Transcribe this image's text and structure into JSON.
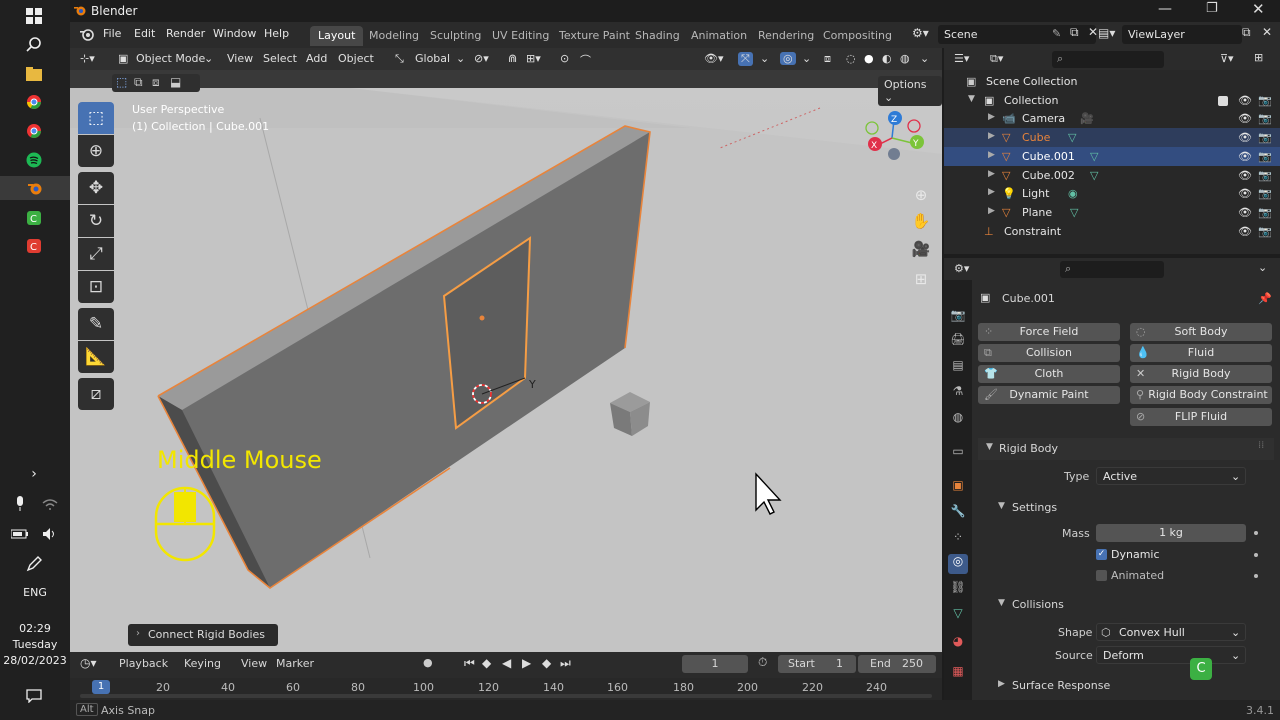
{
  "taskbar": {
    "time": "02:29",
    "day": "Tuesday",
    "date": "28/02/2023",
    "lang": "ENG"
  },
  "window": {
    "title": "Blender"
  },
  "menu": [
    "File",
    "Edit",
    "Render",
    "Window",
    "Help"
  ],
  "workspaces": [
    "Layout",
    "Modeling",
    "Sculpting",
    "UV Editing",
    "Texture Paint",
    "Shading",
    "Animation",
    "Rendering",
    "Compositing"
  ],
  "scene": {
    "name": "Scene",
    "view_layer": "ViewLayer"
  },
  "viewport": {
    "mode": "Object Mode",
    "menus": [
      "View",
      "Select",
      "Add",
      "Object"
    ],
    "orientation": "Global",
    "options_label": "Options",
    "perspective": "User Perspective",
    "collection_info": "(1) Collection | Cube.001",
    "overlay_text": "Middle Mouse",
    "operator_panel": "Connect Rigid Bodies",
    "axis_label_y": "Y"
  },
  "timeline": {
    "menus": [
      "Playback",
      "Keying",
      "View",
      "Marker"
    ],
    "current_frame": "1",
    "start_label": "Start",
    "start": "1",
    "end_label": "End",
    "end": "250",
    "ruler": [
      "1",
      "20",
      "40",
      "60",
      "80",
      "100",
      "120",
      "140",
      "160",
      "180",
      "200",
      "220",
      "240"
    ]
  },
  "status": {
    "key": "Alt",
    "hint": "Axis Snap",
    "version": "3.4.1"
  },
  "outliner": {
    "scene_collection": "Scene Collection",
    "collection": "Collection",
    "items": [
      {
        "name": "Camera",
        "color": "#e6e6e6"
      },
      {
        "name": "Cube",
        "color": "#e8843b"
      },
      {
        "name": "Cube.001",
        "color": "#ffffff"
      },
      {
        "name": "Cube.002",
        "color": "#e6e6e6"
      },
      {
        "name": "Light",
        "color": "#e6e6e6"
      },
      {
        "name": "Plane",
        "color": "#e6e6e6"
      }
    ],
    "constraint": "Constraint"
  },
  "properties": {
    "object_name": "Cube.001",
    "physics_buttons": [
      "Force Field",
      "Soft Body",
      "Collision",
      "Fluid",
      "Cloth",
      "Rigid Body",
      "Dynamic Paint",
      "Rigid Body Constraint",
      "FLIP Fluid"
    ],
    "rigid_body": {
      "header": "Rigid Body",
      "type_label": "Type",
      "type_value": "Active",
      "settings_header": "Settings",
      "mass_label": "Mass",
      "mass_value": "1 kg",
      "dynamic_label": "Dynamic",
      "dynamic_checked": true,
      "animated_label": "Animated",
      "animated_checked": false,
      "collisions_header": "Collisions",
      "shape_label": "Shape",
      "shape_value": "Convex Hull",
      "source_label": "Source",
      "source_value": "Deform",
      "surface_response": "Surface Response"
    }
  },
  "colors": {
    "accent": "#4772b3",
    "selection_outline": "#e8843b",
    "overlay_yellow": "#f2e600"
  }
}
